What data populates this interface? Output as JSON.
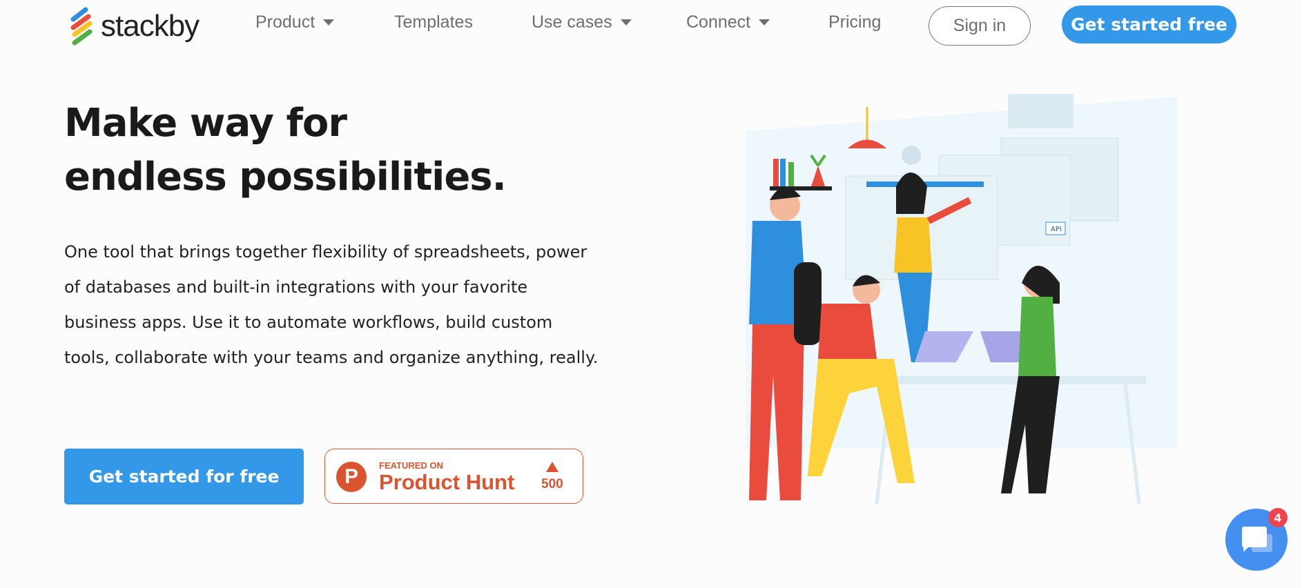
{
  "header": {
    "logo_text": "stackby",
    "nav": [
      {
        "label": "Product",
        "dropdown": true
      },
      {
        "label": "Templates",
        "dropdown": false
      },
      {
        "label": "Use cases",
        "dropdown": true
      },
      {
        "label": "Connect",
        "dropdown": true
      },
      {
        "label": "Pricing",
        "dropdown": false
      }
    ],
    "sign_in": "Sign in",
    "get_started": "Get started free"
  },
  "hero": {
    "headline": "Make way for endless possibilities.",
    "description": "One tool that brings together flexibility of spreadsheets, power of databases and built-in integrations with your favorite business apps. Use it to automate workflows, build custom tools, collaborate with your teams and organize anything, really.",
    "cta": "Get started for free",
    "product_hunt": {
      "featured": "FEATURED ON",
      "name": "Product Hunt",
      "logo_letter": "P",
      "upvotes": "500"
    }
  },
  "illustration": {
    "api_label": "API"
  },
  "chat": {
    "unread_count": "4"
  },
  "colors": {
    "primary": "#3498e8",
    "product_hunt": "#da552f",
    "chat": "#4390f0",
    "badge": "#f0444d"
  }
}
